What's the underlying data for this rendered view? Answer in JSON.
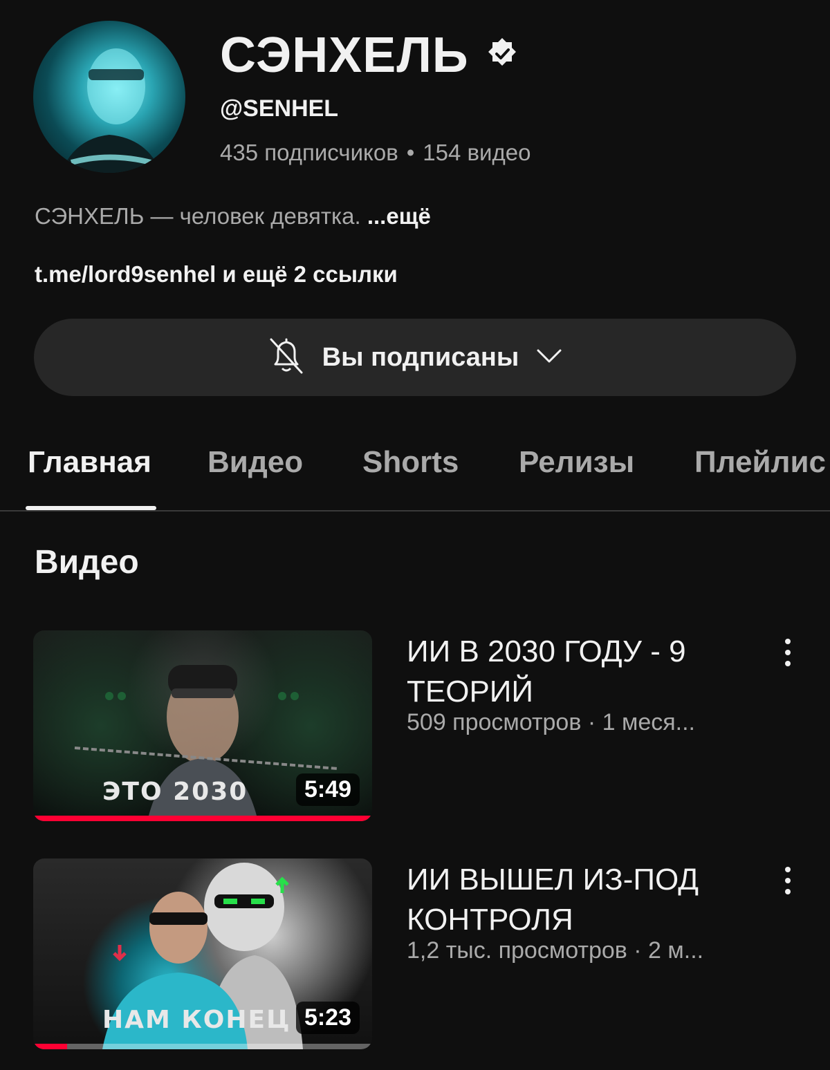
{
  "channel": {
    "name": "СЭНХЕЛЬ",
    "handle": "@SENHEL",
    "subscribers": "435 подписчиков",
    "separator": "•",
    "videos_count": "154 видео",
    "description": "СЭНХЕЛЬ — человек девятка.",
    "more": "...ещё",
    "links": "t.me/lord9senhel и ещё 2 ссылки"
  },
  "subscribe": {
    "label": "Вы подписаны",
    "bell_icon": "bell-off-icon",
    "chevron_icon": "chevron-down-icon"
  },
  "tabs": [
    {
      "label": "Главная",
      "active": true
    },
    {
      "label": "Видео"
    },
    {
      "label": "Shorts"
    },
    {
      "label": "Релизы"
    },
    {
      "label": "Плейлис"
    }
  ],
  "section": {
    "title": "Видео"
  },
  "videos": [
    {
      "title": "ИИ В 2030 ГОДУ - 9 ТЕОРИЙ",
      "meta": "509 просмотров · 1 меся...",
      "duration": "5:49",
      "thumb_caption": "ЭТО 2030",
      "watched_fraction": 1.0
    },
    {
      "title": "ИИ ВЫШЕЛ ИЗ-ПОД КОНТРОЛЯ",
      "meta": "1,2 тыс. просмотров · 2 м...",
      "duration": "5:23",
      "thumb_caption": "НАМ КОНЕЦ",
      "watched_fraction": 0.1
    }
  ],
  "colors": {
    "background": "#0f0f0f",
    "button_bg": "#272727",
    "progress": "#ff0033",
    "secondary_text": "#aaaaaa"
  }
}
